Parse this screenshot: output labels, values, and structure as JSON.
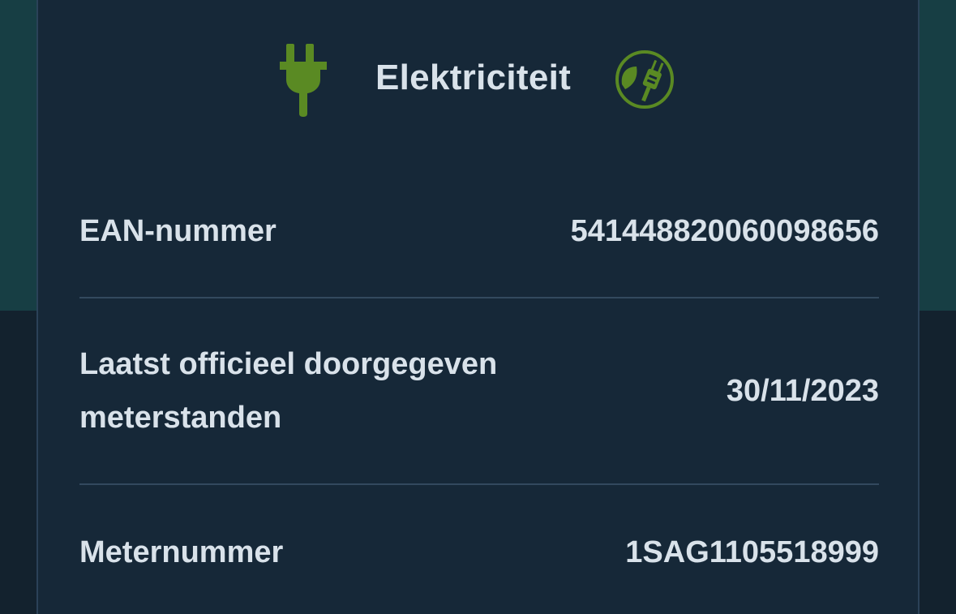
{
  "card": {
    "title": "Elektriciteit",
    "icons": [
      "plug-icon",
      "eco-plug-icon"
    ],
    "accent_color": "#5a8a23"
  },
  "details": [
    {
      "label": "EAN-nummer",
      "value": "541448820060098656"
    },
    {
      "label_line1": "Laatst officieel doorgegeven",
      "label_line2": "meterstanden",
      "value": "30/11/2023"
    },
    {
      "label": "Meternummer",
      "value": "1SAG1105518999"
    }
  ]
}
